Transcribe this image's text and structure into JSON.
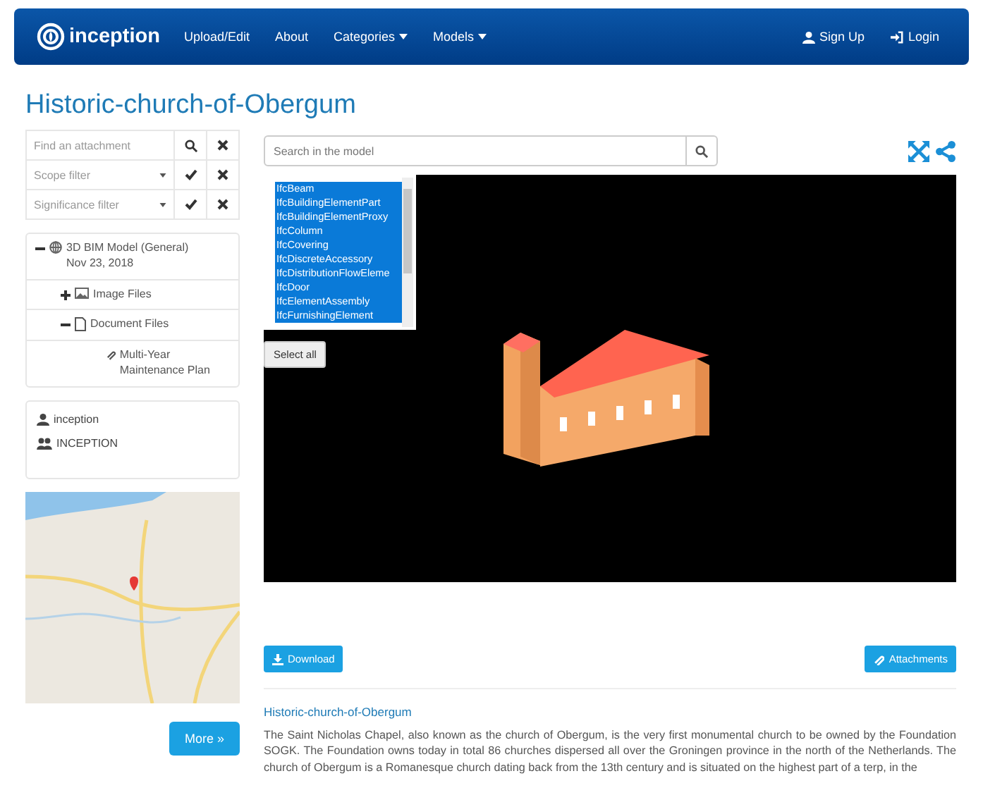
{
  "navbar": {
    "brand": "inception",
    "items": [
      {
        "label": "Upload/Edit",
        "kind": "link"
      },
      {
        "label": "About",
        "kind": "link"
      },
      {
        "label": "Categories",
        "kind": "dropdown"
      },
      {
        "label": "Models",
        "kind": "dropdown"
      }
    ],
    "right_items": [
      {
        "label": "Sign Up",
        "kind": "user"
      },
      {
        "label": "Login",
        "kind": "login"
      }
    ]
  },
  "page_title": "Historic-church-of-Obergum",
  "filters": [
    {
      "placeholder": "Find an attachment",
      "kind": "search"
    },
    {
      "placeholder": "Scope filter",
      "kind": "select"
    },
    {
      "placeholder": "Significance filter",
      "kind": "select"
    }
  ],
  "tree": [
    {
      "label": "3D BIM Model (General)",
      "date": "Nov 23, 2018",
      "kind": "model",
      "expanded": true,
      "children": [
        {
          "label": "Image Files",
          "kind": "image",
          "expanded": false
        },
        {
          "label": "Document Files",
          "kind": "document",
          "expanded": true,
          "children": [
            {
              "label": "Multi-Year Maintenance Plan",
              "kind": "attachment"
            }
          ]
        }
      ]
    }
  ],
  "owners": [
    {
      "label": "inception",
      "kind": "user"
    },
    {
      "label": "INCEPTION",
      "kind": "group"
    }
  ],
  "more_button": "More »",
  "model_search": {
    "placeholder": "Search in the model"
  },
  "ifc_types": [
    {
      "label": "IfcBeam",
      "selected": true
    },
    {
      "label": "IfcBuildingElementPart",
      "selected": true
    },
    {
      "label": "IfcBuildingElementProxy",
      "selected": true
    },
    {
      "label": "IfcColumn",
      "selected": true
    },
    {
      "label": "IfcCovering",
      "selected": true
    },
    {
      "label": "IfcDiscreteAccessory",
      "selected": true
    },
    {
      "label": "IfcDistributionFlowEleme",
      "selected": true
    },
    {
      "label": "IfcDoor",
      "selected": true
    },
    {
      "label": "IfcElementAssembly",
      "selected": true
    },
    {
      "label": "IfcFurnishingElement",
      "selected": true
    }
  ],
  "select_all_button": "Select all",
  "download_button": "Download",
  "attachments_button": "Attachments",
  "description": {
    "title": "Historic-church-of-Obergum",
    "text": "The Saint Nicholas Chapel, also known as the church of Obergum, is the very first monumental church to be owned by the Foundation SOGK. The Foundation owns today in total 86 churches dispersed all over the Groningen province in the north of the Netherlands. The church of Obergum is a Romanesque church dating back from the 13th century and is situated on the highest part of a terp, in the"
  }
}
